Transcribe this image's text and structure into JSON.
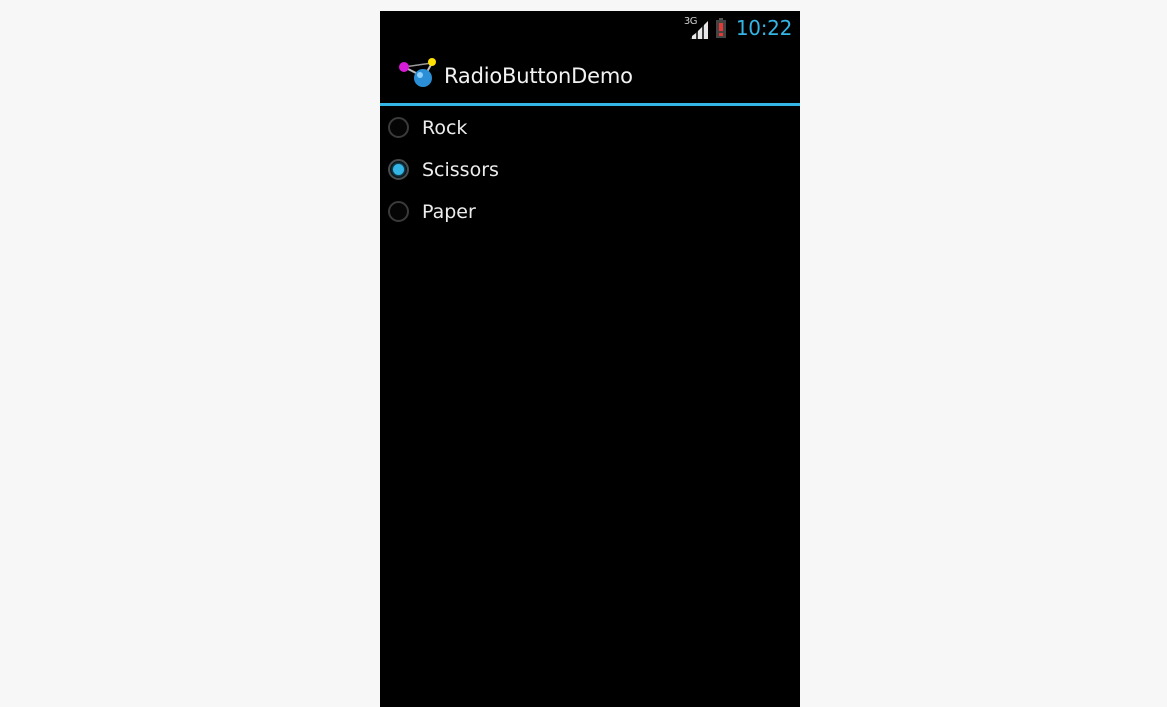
{
  "status_bar": {
    "network_type": "3G",
    "signal_icon": "cell-signal-icon",
    "battery_icon": "battery-low-icon",
    "time": "10:22",
    "accent_color": "#33b5e5"
  },
  "action_bar": {
    "app_icon": "app-logo-icon",
    "title": "RadioButtonDemo"
  },
  "radio_group": {
    "options": [
      {
        "label": "Rock",
        "checked": false
      },
      {
        "label": "Scissors",
        "checked": true
      },
      {
        "label": "Paper",
        "checked": false
      }
    ]
  }
}
